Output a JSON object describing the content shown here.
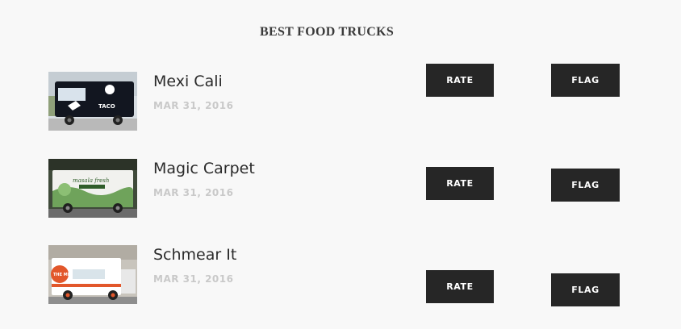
{
  "page": {
    "title": "BEST FOOD TRUCKS"
  },
  "trucks": [
    {
      "name": "Mexi Cali",
      "date": "MAR 31, 2016",
      "rate_label": "RATE",
      "flag_label": "FLAG",
      "image_text": "TACO"
    },
    {
      "name": "Magic Carpet",
      "date": "MAR 31, 2016",
      "rate_label": "RATE",
      "flag_label": "FLAG",
      "image_text": "masala fresh"
    },
    {
      "name": "Schmear It",
      "date": "MAR 31, 2016",
      "rate_label": "RATE",
      "flag_label": "FLAG",
      "image_text": "THE MELT"
    }
  ],
  "colors": {
    "background": "#f8f8f8",
    "button_bg": "#262626",
    "button_text": "#ffffff",
    "date_text": "#c9c9c9"
  }
}
